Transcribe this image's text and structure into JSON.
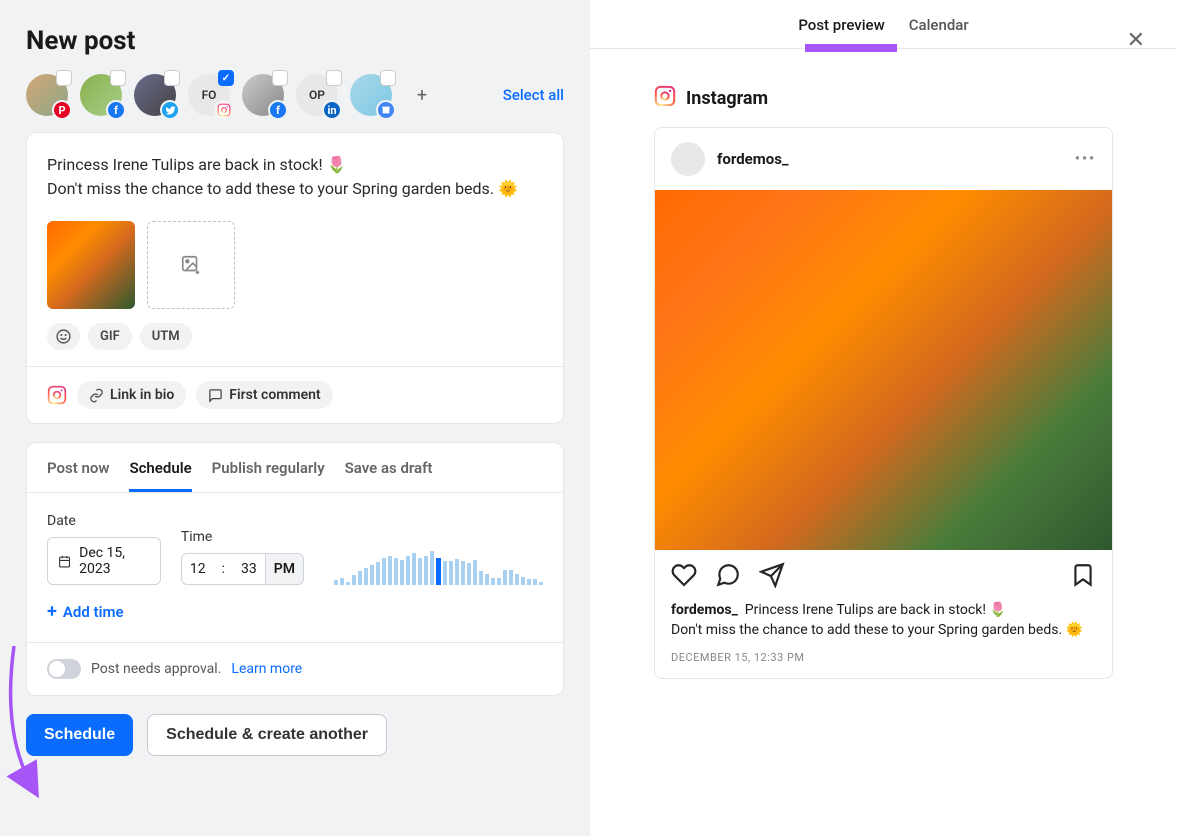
{
  "title": "New post",
  "accounts": {
    "items": [
      {
        "network": "pinterest",
        "checked": false
      },
      {
        "network": "facebook",
        "checked": false
      },
      {
        "network": "twitter",
        "checked": false
      },
      {
        "network": "instagram",
        "checked": true,
        "initials": "FO"
      },
      {
        "network": "facebook",
        "checked": false
      },
      {
        "network": "linkedin",
        "checked": false,
        "initials": "OP"
      },
      {
        "network": "gmb",
        "checked": false
      }
    ],
    "select_all": "Select all"
  },
  "composer": {
    "text_line1": "Princess Irene Tulips are back in stock! 🌷",
    "text_line2": "Don't miss the chance to add these to your Spring garden beds. 🌞",
    "chip_gif": "GIF",
    "chip_utm": "UTM",
    "link_in_bio": "Link in bio",
    "first_comment": "First comment"
  },
  "schedule": {
    "tabs": {
      "now": "Post now",
      "schedule": "Schedule",
      "regular": "Publish regularly",
      "draft": "Save as draft"
    },
    "date_label": "Date",
    "date_value": "Dec 15, 2023",
    "time_label": "Time",
    "time_hour": "12",
    "time_min": "33",
    "time_ampm": "PM",
    "add_time": "Add time",
    "approval": "Post needs approval.",
    "learn_more": "Learn more"
  },
  "chart_data": {
    "type": "bar",
    "title": "",
    "xlabel": "",
    "ylabel": "",
    "categories": [],
    "values": [
      4,
      6,
      3,
      9,
      12,
      15,
      18,
      20,
      24,
      26,
      24,
      22,
      26,
      28,
      24,
      26,
      30,
      24,
      21,
      21,
      23,
      21,
      19,
      22,
      12,
      10,
      6,
      6,
      13,
      13,
      10,
      7,
      5,
      5,
      3
    ]
  },
  "buttons": {
    "schedule": "Schedule",
    "schedule_another": "Schedule & create another"
  },
  "preview": {
    "tabs": {
      "preview": "Post preview",
      "calendar": "Calendar"
    },
    "platform": "Instagram",
    "username": "fordemos_",
    "caption_user": "fordemos_",
    "caption_l1": "Princess Irene Tulips are back in stock! 🌷",
    "caption_l2": "Don't miss the chance to add these to your Spring garden beds. 🌞",
    "timestamp": "DECEMBER 15, 12:33 PM"
  }
}
